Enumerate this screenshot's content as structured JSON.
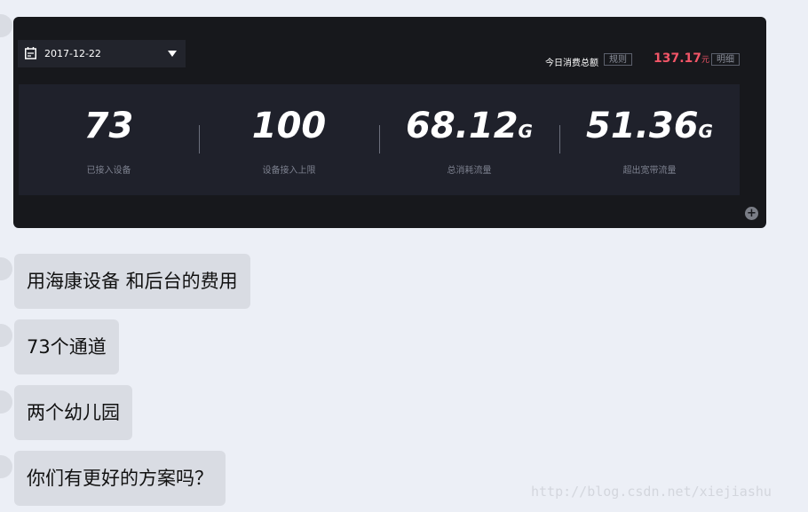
{
  "screenshot": {
    "date": "2017-12-22",
    "today_total_label": "今日消费总额",
    "rules_label": "规则",
    "amount_value": "137.17",
    "amount_unit": "元",
    "detail_label": "明细",
    "stats": [
      {
        "value": "73",
        "unit": "",
        "caption": "已接入设备"
      },
      {
        "value": "100",
        "unit": "",
        "caption": "设备接入上限"
      },
      {
        "value": "68.12",
        "unit": "G",
        "caption": "总消耗流量"
      },
      {
        "value": "51.36",
        "unit": "G",
        "caption": "超出宽带流量"
      }
    ],
    "zoom_icon": "plus-icon"
  },
  "messages": [
    {
      "text": "用海康设备 和后台的费用"
    },
    {
      "text": "73个通道"
    },
    {
      "text": "两个幼儿园"
    },
    {
      "text": "你们有更好的方案吗？"
    }
  ],
  "watermark": "http://blog.csdn.net/xiejiashu",
  "colors": {
    "page_bg": "#eceff6",
    "card_bg": "#17181c",
    "panel_bg": "#1f212b",
    "bubble_bg": "#d9dce3",
    "amount": "#f25567"
  }
}
